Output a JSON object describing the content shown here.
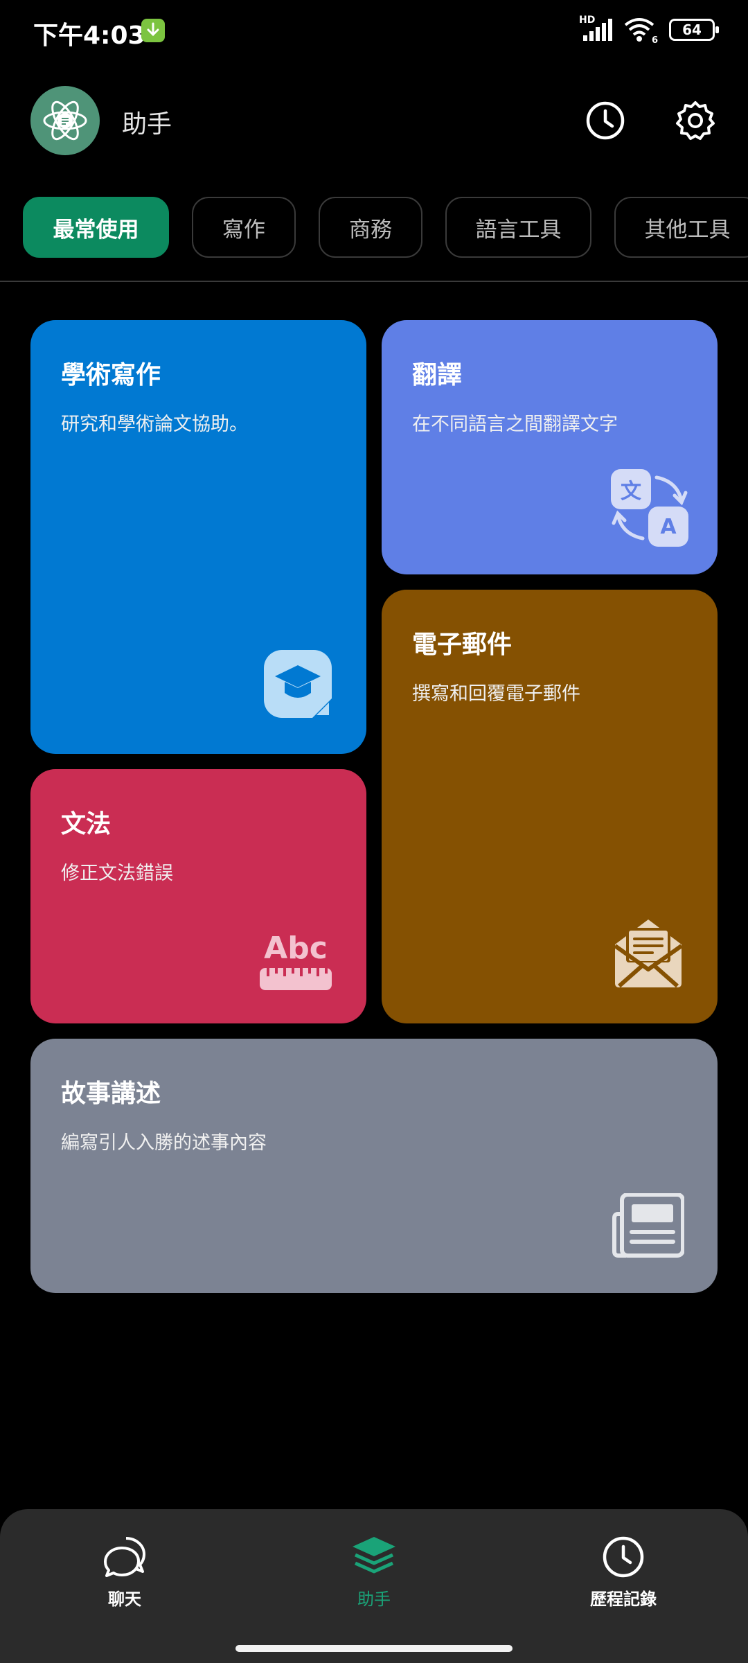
{
  "status_bar": {
    "time": "下午4:03",
    "network": "HD",
    "wifi_level": "6",
    "battery": "64"
  },
  "header": {
    "title": "助手"
  },
  "tabs": [
    {
      "label": "最常使用",
      "active": true
    },
    {
      "label": "寫作",
      "active": false
    },
    {
      "label": "商務",
      "active": false
    },
    {
      "label": "語言工具",
      "active": false
    },
    {
      "label": "其他工具",
      "active": false
    }
  ],
  "cards": {
    "academic": {
      "title": "學術寫作",
      "desc": "研究和學術論文協助。",
      "color": "#0179d2",
      "icon": "graduation-cap-icon"
    },
    "translate": {
      "title": "翻譯",
      "desc": "在不同語言之間翻譯文字",
      "color": "#5f7fe6",
      "icon": "translate-icon"
    },
    "email": {
      "title": "電子郵件",
      "desc": "撰寫和回覆電子郵件",
      "color": "#855102",
      "icon": "open-envelope-icon"
    },
    "grammar": {
      "title": "文法",
      "desc": "修正文法錯誤",
      "color": "#ca2d53",
      "icon": "abc-ruler-icon"
    },
    "story": {
      "title": "故事講述",
      "desc": "編寫引人入勝的述事內容",
      "color": "#7c8393",
      "icon": "newspaper-icon"
    }
  },
  "bottom_nav": [
    {
      "label": "聊天",
      "active": false
    },
    {
      "label": "助手",
      "active": true
    },
    {
      "label": "歷程記錄",
      "active": false
    }
  ],
  "icon_glyphs": {
    "translate_src": "文",
    "translate_dst": "A",
    "grammar": "Abc"
  },
  "colors": {
    "accent": "#0c8a5f",
    "nav_active": "#1aa378"
  }
}
